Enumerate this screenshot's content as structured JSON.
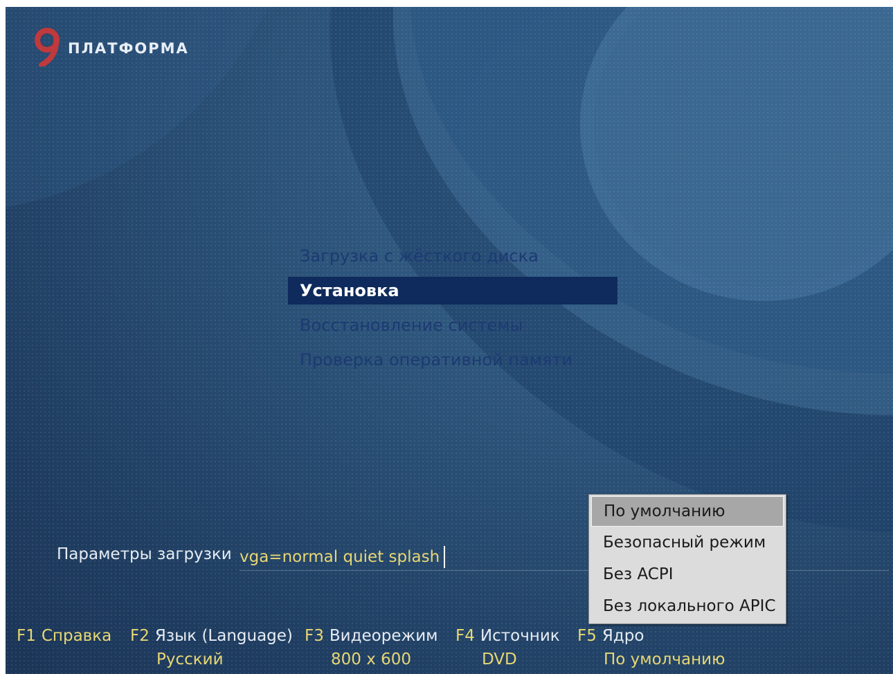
{
  "logo": {
    "text": "ПЛАТФОРМА",
    "mark_icon": "platforma-logo-icon",
    "mark_color": "#c0393d"
  },
  "boot_menu": {
    "items": [
      {
        "label": "Загрузка с жёсткого диска",
        "selected": false
      },
      {
        "label": "Установка",
        "selected": true
      },
      {
        "label": "Восстановление системы",
        "selected": false
      },
      {
        "label": "Проверка оперативной памяти",
        "selected": false
      }
    ],
    "item_color": "#1c3a72",
    "selected_bg": "#0f2a5c"
  },
  "boot_params": {
    "label": "Параметры загрузки",
    "value": "vga=normal quiet splash"
  },
  "kernel_popup": {
    "options": [
      {
        "label": "По умолчанию",
        "selected": true
      },
      {
        "label": "Безопасный режим",
        "selected": false
      },
      {
        "label": "Без ACPI",
        "selected": false
      },
      {
        "label": "Без локального APIC",
        "selected": false
      }
    ]
  },
  "function_keys": [
    {
      "key": "F1",
      "label": "Справка",
      "value": ""
    },
    {
      "key": "F2",
      "label": "Язык (Language)",
      "value": "Русский"
    },
    {
      "key": "F3",
      "label": "Видеорежим",
      "value": "800 x 600"
    },
    {
      "key": "F4",
      "label": "Источник",
      "value": "DVD"
    },
    {
      "key": "F5",
      "label": "Ядро",
      "value": "По умолчанию"
    }
  ],
  "colors": {
    "accent_yellow": "#e8d774",
    "text_light": "#e6ecf3",
    "background_blue": "#2c5379"
  }
}
